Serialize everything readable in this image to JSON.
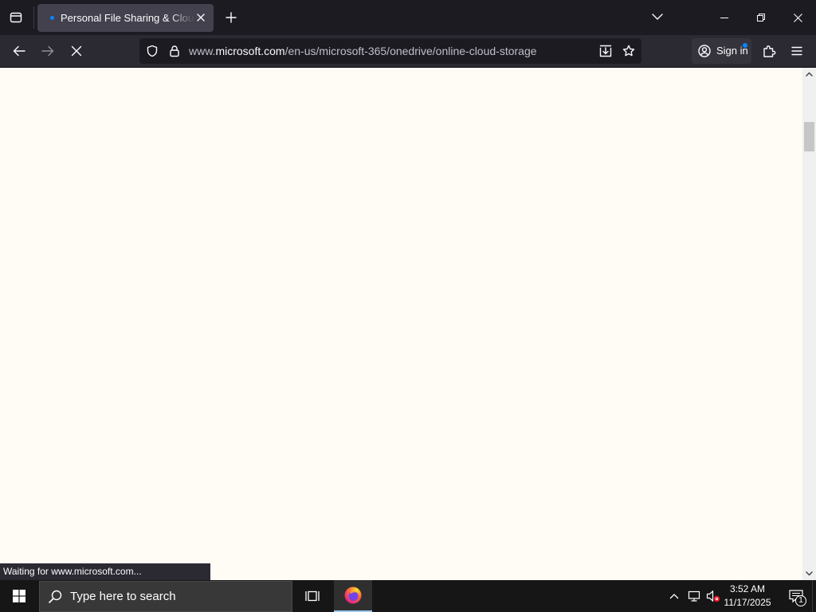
{
  "browser": {
    "tab_title": "Personal File Sharing & Cloud S",
    "url_prefix": "www.",
    "url_domain": "microsoft.com",
    "url_path": "/en-us/microsoft-365/onedrive/online-cloud-storage",
    "sign_in_label": "Sign in",
    "status_text": "Waiting for www.microsoft.com..."
  },
  "taskbar": {
    "search_placeholder": "Type here to search",
    "clock_time": "3:52 AM",
    "clock_date": "11/17/2025",
    "notification_count": "1"
  },
  "icons": [
    "firefox-view-icon",
    "tab-loading-icon",
    "tab-close-icon",
    "new-tab-icon",
    "list-all-tabs-icon",
    "minimize-icon",
    "restore-icon",
    "window-close-icon",
    "back-icon",
    "forward-icon",
    "stop-icon",
    "shield-icon",
    "lock-icon",
    "save-page-icon",
    "bookmark-star-icon",
    "account-icon",
    "extensions-icon",
    "menu-icon",
    "scroll-up-icon",
    "scroll-down-icon",
    "windows-start-icon",
    "search-icon",
    "task-view-icon",
    "firefox-icon",
    "chevron-up-icon",
    "network-icon",
    "volume-muted-icon",
    "notifications-icon"
  ],
  "colors": {
    "titlebar": "#1c1b22",
    "toolbar": "#2b2a33",
    "active_tab": "#42414d",
    "urlbar": "#1c1b22",
    "page_background": "#fffbf5",
    "accent": "#0a84ff",
    "taskbar": "#161616"
  }
}
